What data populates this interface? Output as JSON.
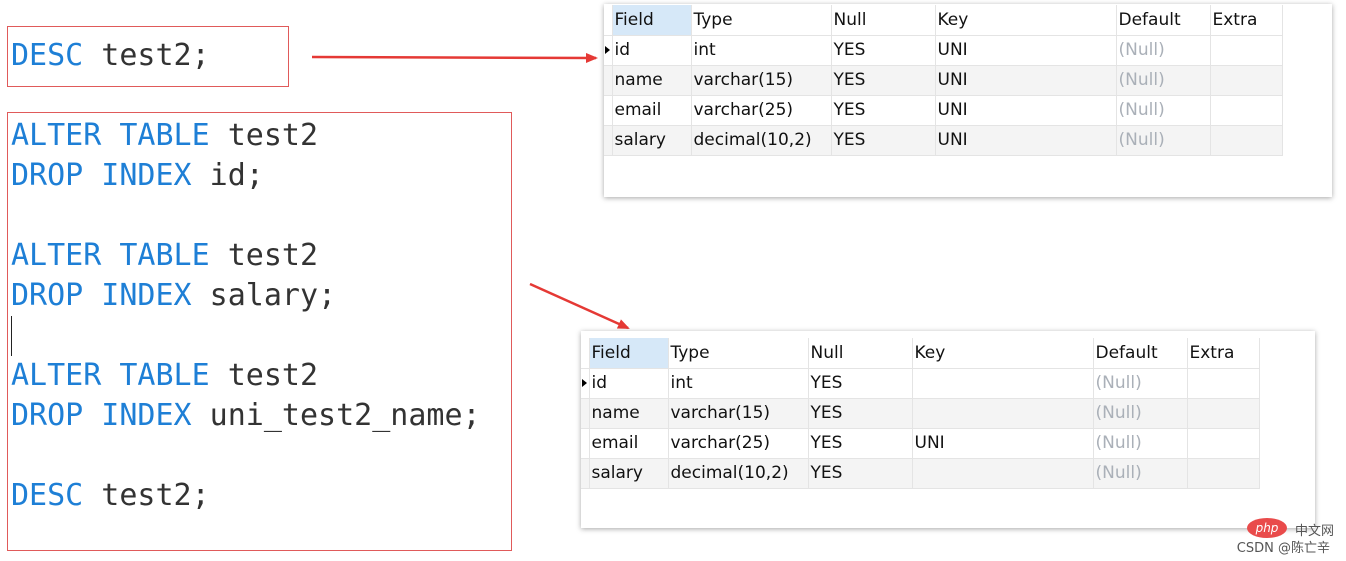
{
  "code_top": {
    "lines": [
      {
        "kw": "DESC",
        "rest": " test2;"
      }
    ]
  },
  "code_main": {
    "lines": [
      {
        "kw": "ALTER TABLE",
        "rest": " test2"
      },
      {
        "kw": "DROP INDEX",
        "rest": " id;"
      },
      {
        "kw": "",
        "rest": ""
      },
      {
        "kw": "ALTER TABLE",
        "rest": " test2"
      },
      {
        "kw": "DROP INDEX",
        "rest": " salary;"
      },
      {
        "kw": "",
        "rest": ""
      },
      {
        "kw": "ALTER TABLE",
        "rest": " test2"
      },
      {
        "kw": "DROP INDEX",
        "rest": " uni_test2_name;"
      },
      {
        "kw": "",
        "rest": ""
      },
      {
        "kw": "DESC",
        "rest": " test2;"
      }
    ]
  },
  "grid_before": {
    "columns": [
      "Field",
      "Type",
      "Null",
      "Key",
      "Default",
      "Extra"
    ],
    "rows": [
      [
        "id",
        "int",
        "YES",
        "UNI",
        "(Null)",
        ""
      ],
      [
        "name",
        "varchar(15)",
        "YES",
        "UNI",
        "(Null)",
        ""
      ],
      [
        "email",
        "varchar(25)",
        "YES",
        "UNI",
        "(Null)",
        ""
      ],
      [
        "salary",
        "decimal(10,2)",
        "YES",
        "UNI",
        "(Null)",
        ""
      ]
    ]
  },
  "grid_after": {
    "columns": [
      "Field",
      "Type",
      "Null",
      "Key",
      "Default",
      "Extra"
    ],
    "rows": [
      [
        "id",
        "int",
        "YES",
        "",
        "(Null)",
        ""
      ],
      [
        "name",
        "varchar(15)",
        "YES",
        "",
        "(Null)",
        ""
      ],
      [
        "email",
        "varchar(25)",
        "YES",
        "UNI",
        "(Null)",
        ""
      ],
      [
        "salary",
        "decimal(10,2)",
        "YES",
        "",
        "(Null)",
        ""
      ]
    ]
  },
  "watermark": {
    "logo": "php",
    "site": "中文网",
    "author": "CSDN @陈亡辛"
  },
  "colors": {
    "keyword": "#1e7fd6",
    "text": "#333333",
    "box_border": "#e05a5a",
    "arrow": "#e53935",
    "null_text": "#aab0b8",
    "header_selected": "#d6e8f8"
  }
}
